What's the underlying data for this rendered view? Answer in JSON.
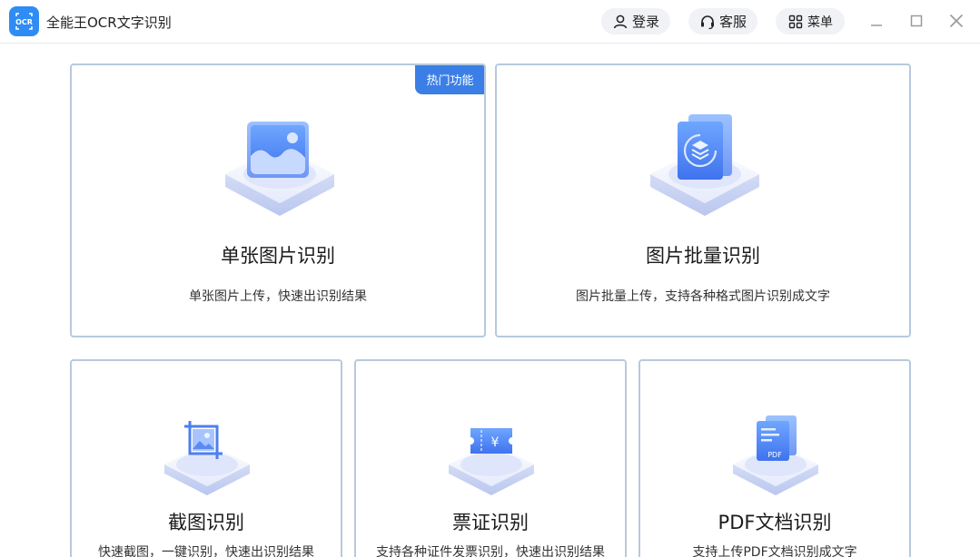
{
  "app": {
    "title": "全能王OCR文字识别",
    "logo_text": "OCR",
    "accent_color": "#2f8cf5"
  },
  "header": {
    "login_label": "登录",
    "service_label": "客服",
    "menu_label": "菜单",
    "icons": [
      "user-icon",
      "headset-icon",
      "grid-menu-icon",
      "minimize-icon",
      "maximize-icon",
      "close-icon"
    ]
  },
  "cards": {
    "single": {
      "badge": "热门功能",
      "title": "单张图片识别",
      "desc": "单张图片上传，快速出识别结果",
      "icon": "image-icon"
    },
    "batch": {
      "title": "图片批量识别",
      "desc": "图片批量上传，支持各种格式图片识别成文字",
      "icon": "batch-images-icon"
    },
    "screenshot": {
      "title": "截图识别",
      "desc": "快速截图，一键识别，快速出识别结果",
      "icon": "crop-icon"
    },
    "ticket": {
      "title": "票证识别",
      "desc": "支持各种证件发票识别，快速出识别结果",
      "icon": "ticket-icon"
    },
    "pdf": {
      "title": "PDF文档识别",
      "desc": "支持上传PDF文档识别成文字",
      "icon_text": "PDF",
      "icon": "pdf-document-icon"
    }
  }
}
